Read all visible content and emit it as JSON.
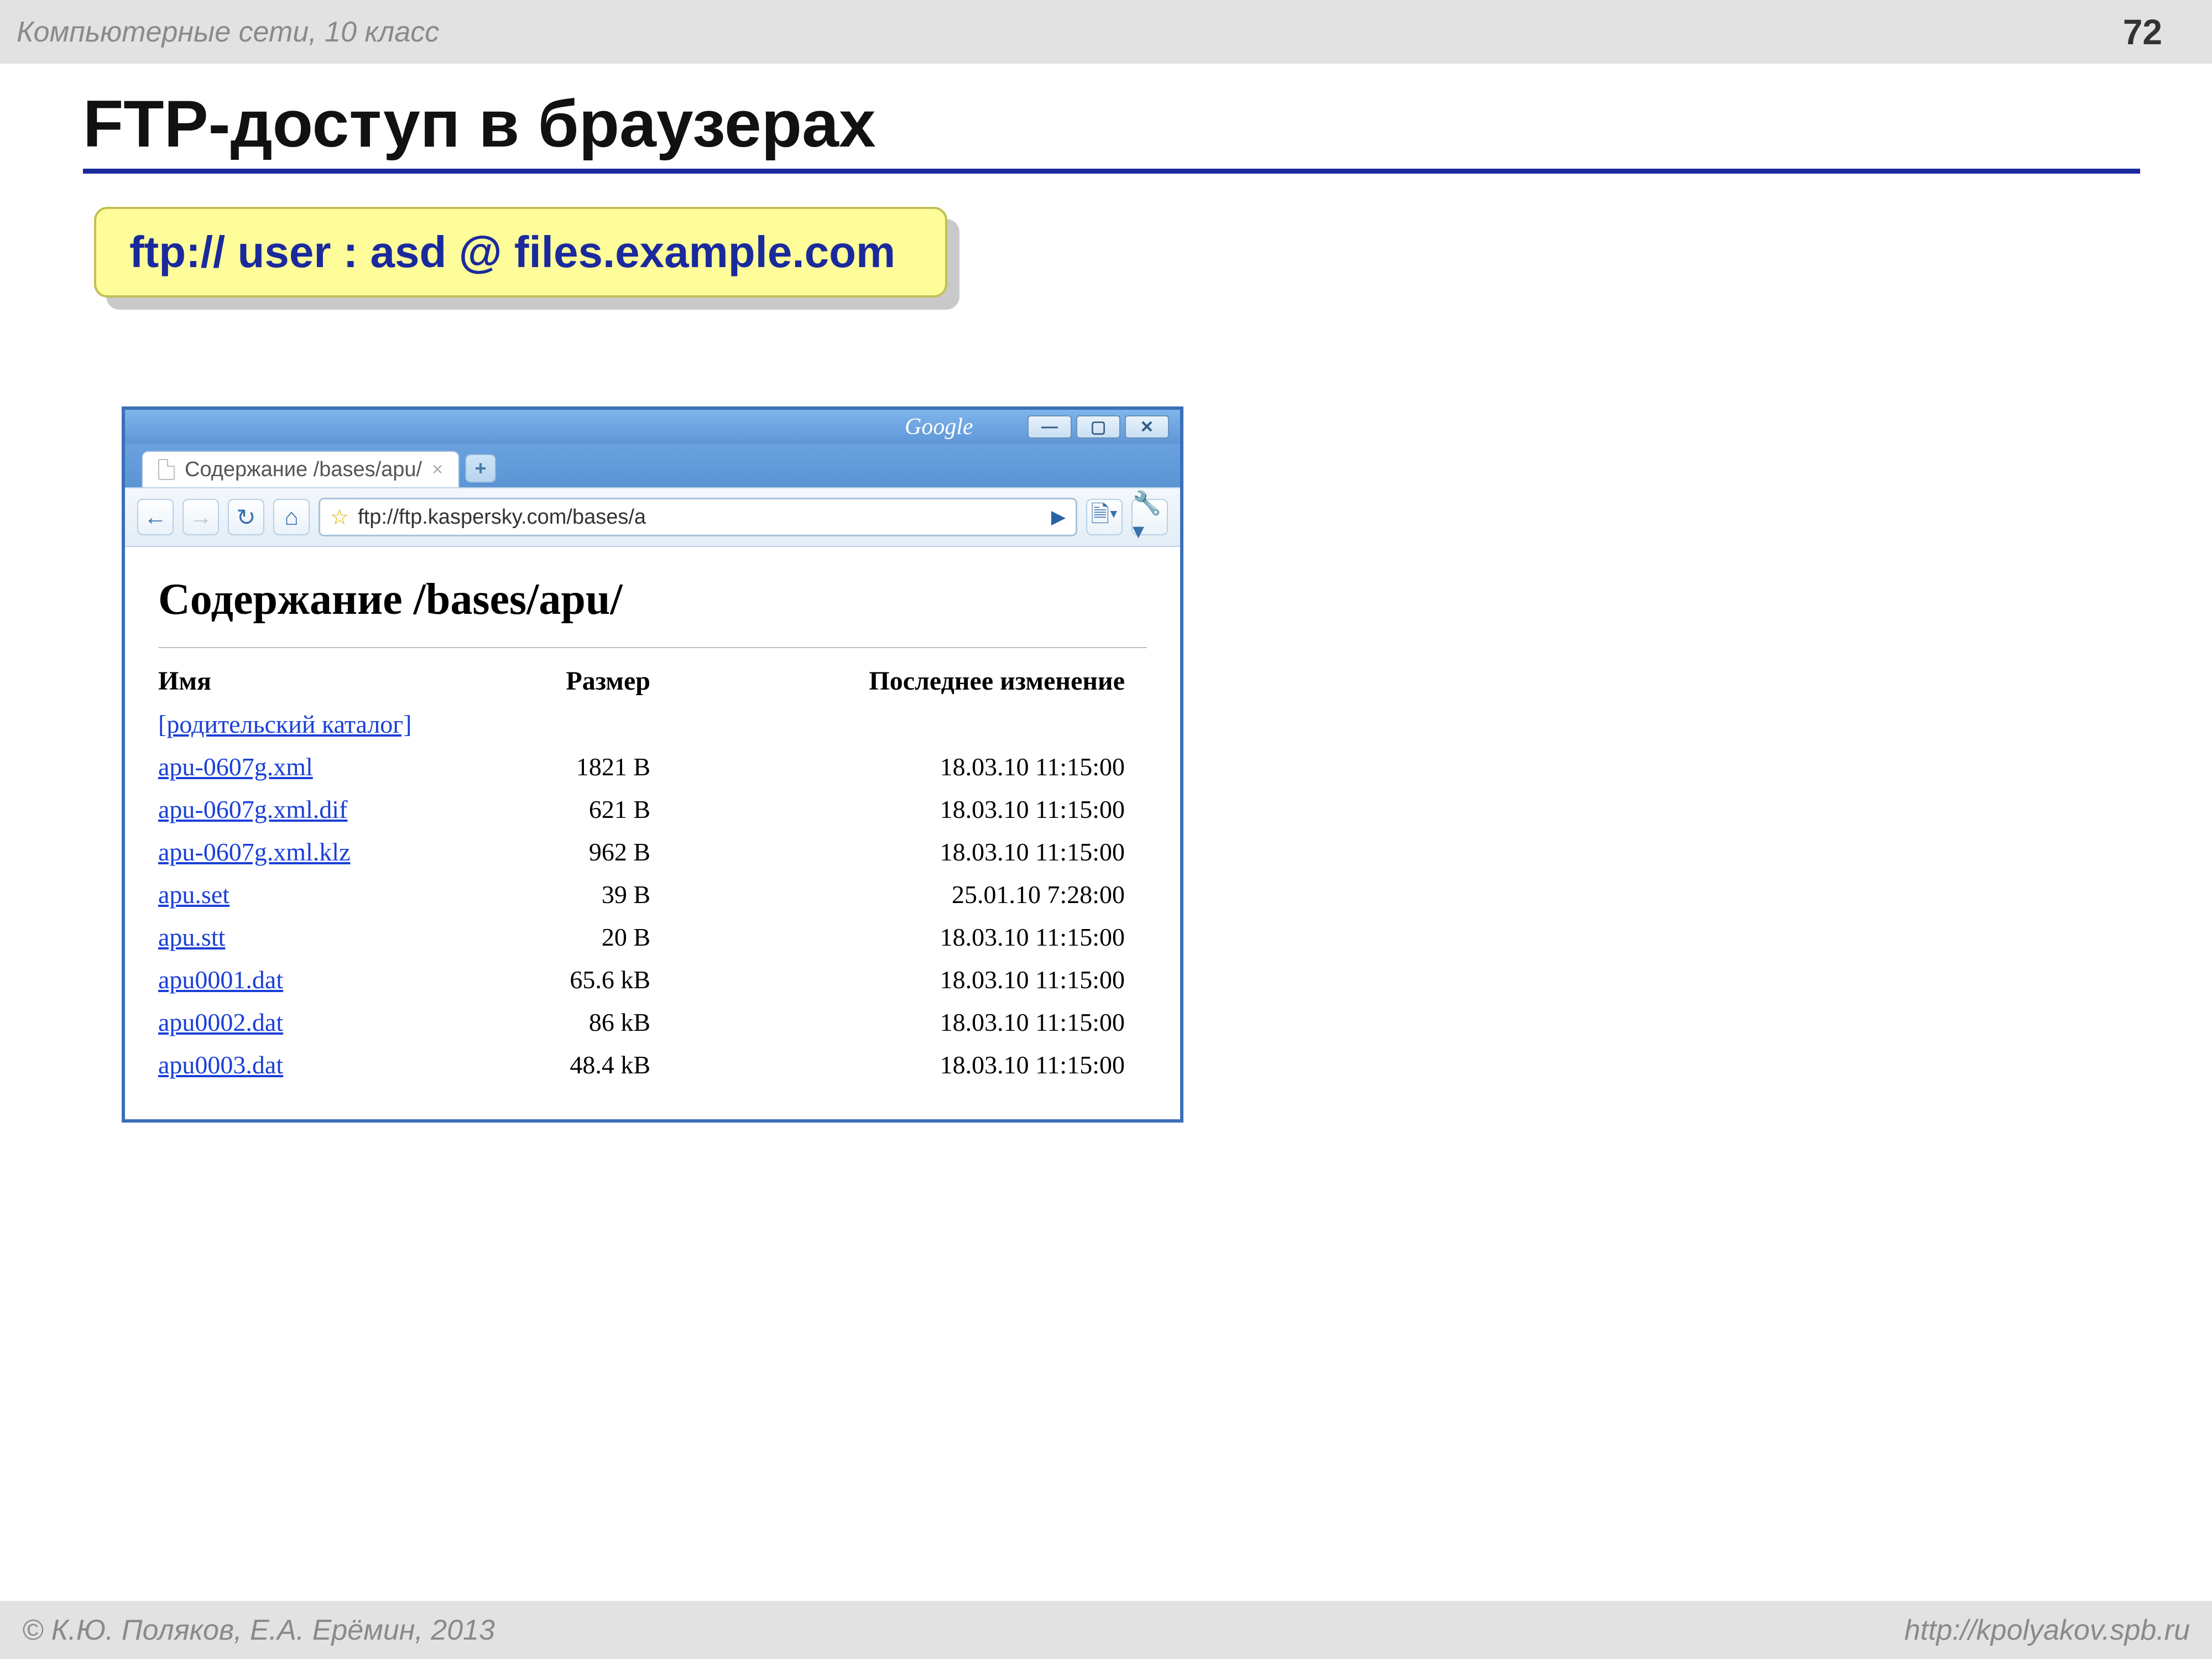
{
  "header": {
    "course": "Компьютерные сети, 10 класс",
    "page_number": "72"
  },
  "title": "FTP-доступ в браузерах",
  "url_example": "ftp:// user : asd @ files.example.com",
  "browser": {
    "titlebar_brand": "Google",
    "tab_title": "Содержание /bases/apu/",
    "address": "ftp://ftp.kaspersky.com/bases/a",
    "content_heading": "Содержание /bases/apu/",
    "columns": {
      "name": "Имя",
      "size": "Размер",
      "modified": "Последнее изменение"
    },
    "parent_label": "[родительский каталог]",
    "files": [
      {
        "name": "apu-0607g.xml",
        "size": "1821 B",
        "modified": "18.03.10 11:15:00"
      },
      {
        "name": "apu-0607g.xml.dif",
        "size": "621 B",
        "modified": "18.03.10 11:15:00"
      },
      {
        "name": "apu-0607g.xml.klz",
        "size": "962 B",
        "modified": "18.03.10 11:15:00"
      },
      {
        "name": "apu.set",
        "size": "39 B",
        "modified": "25.01.10 7:28:00"
      },
      {
        "name": "apu.stt",
        "size": "20 B",
        "modified": "18.03.10 11:15:00"
      },
      {
        "name": "apu0001.dat",
        "size": "65.6 kB",
        "modified": "18.03.10 11:15:00"
      },
      {
        "name": "apu0002.dat",
        "size": "86 kB",
        "modified": "18.03.10 11:15:00"
      },
      {
        "name": "apu0003.dat",
        "size": "48.4 kB",
        "modified": "18.03.10 11:15:00"
      }
    ]
  },
  "footer": {
    "copyright": "© К.Ю. Поляков, Е.А. Ерёмин, 2013",
    "url": "http://kpolyakov.spb.ru"
  }
}
